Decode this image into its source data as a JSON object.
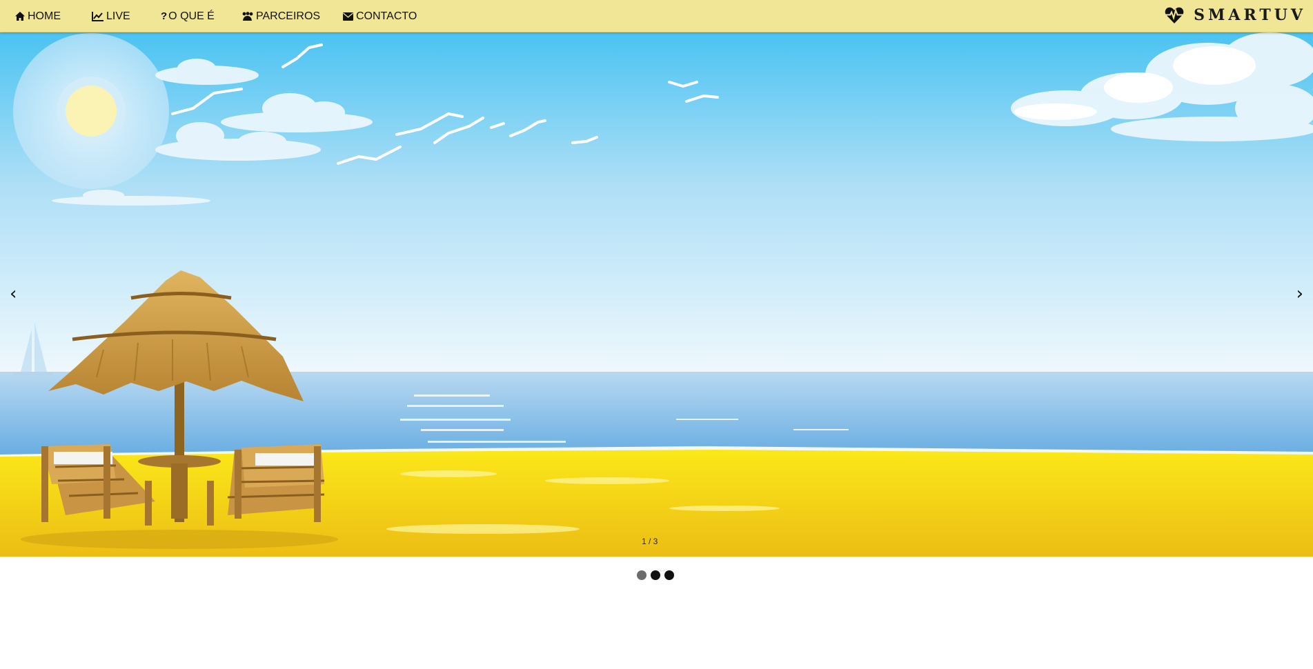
{
  "nav": {
    "items": [
      {
        "label": "HOME",
        "icon": "home-icon"
      },
      {
        "label": "LIVE",
        "icon": "line-chart-icon"
      },
      {
        "label": "O QUE É",
        "icon": "question-icon"
      },
      {
        "label": "PARCEIROS",
        "icon": "paw-icon"
      },
      {
        "label": "CONTACTO",
        "icon": "envelope-icon"
      }
    ],
    "brand": "SMARTUV",
    "brand_icon": "heartbeat-icon"
  },
  "slideshow": {
    "counter": "1 / 3",
    "prev_label": "‹",
    "next_label": "›",
    "active_slide": 1,
    "total_slides": 3
  },
  "colors": {
    "navbar": "#f0e696",
    "sky_top": "#4ac3f2",
    "sand": "#f6dc10",
    "sea": "#7bb8e6"
  }
}
